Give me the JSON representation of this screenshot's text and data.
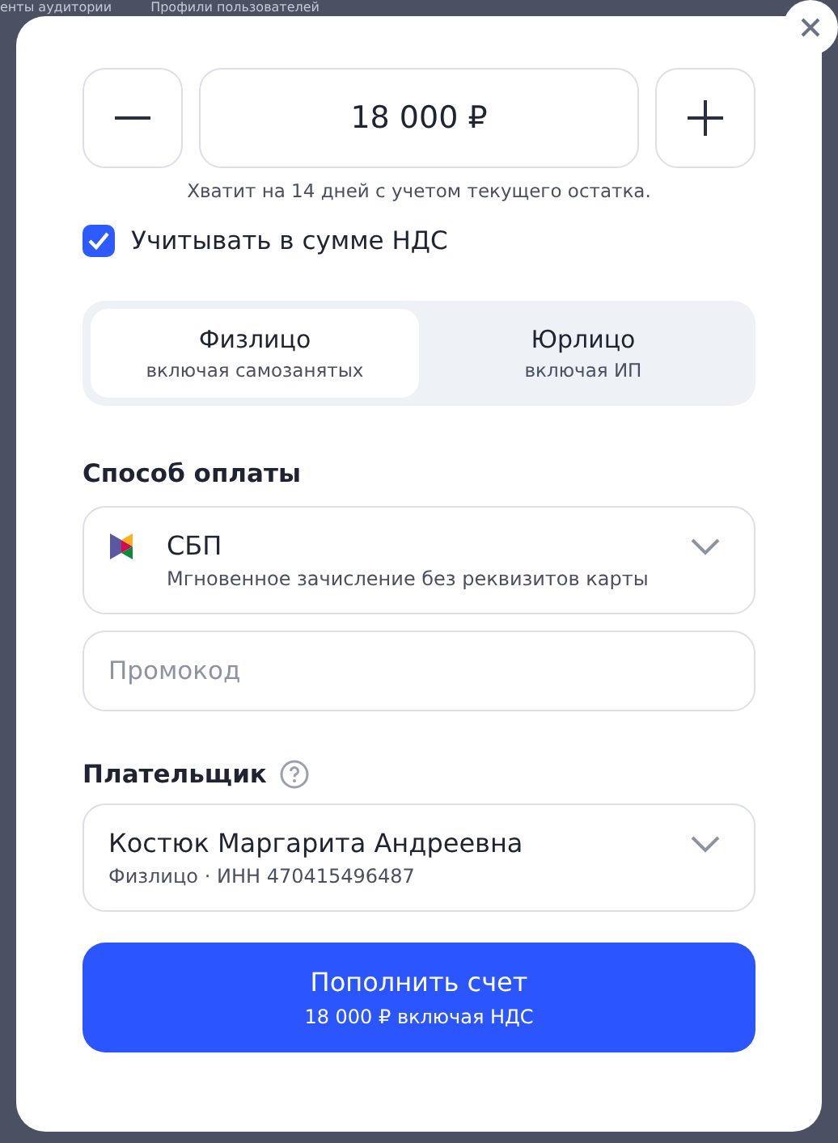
{
  "background_tabs": [
    "енты аудитории",
    "Профили пользователей"
  ],
  "amount": {
    "value": "18 000 ₽",
    "hint": "Хватит на 14 дней с учетом текущего остатка."
  },
  "vat_checkbox": {
    "label": "Учитывать в сумме НДС",
    "checked": true
  },
  "payer_type": [
    {
      "title": "Физлицо",
      "subtitle": "включая самозанятых",
      "selected": true
    },
    {
      "title": "Юрлицо",
      "subtitle": "включая ИП",
      "selected": false
    }
  ],
  "payment_method": {
    "label": "Способ оплаты",
    "title": "СБП",
    "subtitle": "Мгновенное зачисление без реквизитов карты"
  },
  "promo": {
    "placeholder": "Промокод"
  },
  "payer": {
    "label": "Плательщик",
    "name": "Костюк Маргарита Андреевна",
    "type": "Физлицо",
    "separator": "·",
    "inn": "ИНН 470415496487"
  },
  "submit": {
    "title": "Пополнить счет",
    "subtitle": "18 000 ₽ включая НДС"
  }
}
